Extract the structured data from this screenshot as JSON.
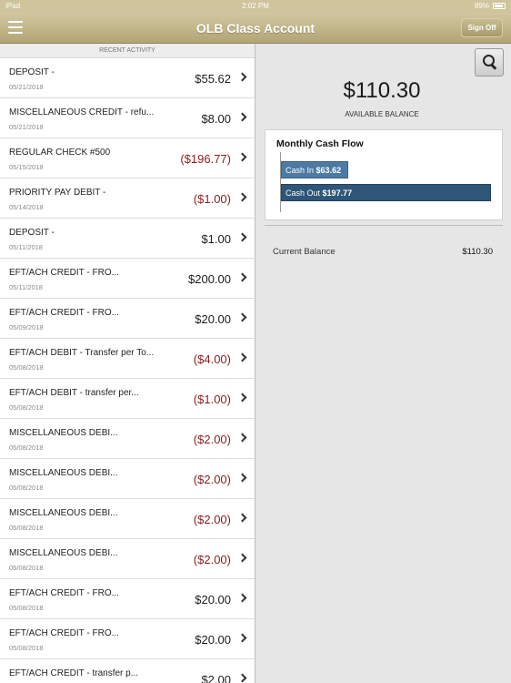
{
  "status_bar": {
    "device": "iPad",
    "time": "2:02 PM",
    "battery": "89%"
  },
  "nav": {
    "title": "OLB Class Account",
    "sign_off": "Sign Off"
  },
  "activity": {
    "header": "RECENT ACTIVITY",
    "transactions": [
      {
        "desc": "DEPOSIT -",
        "date": "05/21/2018",
        "amount": "$55.62",
        "negative": false
      },
      {
        "desc": "MISCELLANEOUS CREDIT - refu...",
        "date": "05/21/2018",
        "amount": "$8.00",
        "negative": false
      },
      {
        "desc": "REGULAR CHECK #500",
        "date": "05/15/2018",
        "amount": "($196.77)",
        "negative": true
      },
      {
        "desc": "PRIORITY PAY DEBIT -",
        "date": "05/14/2018",
        "amount": "($1.00)",
        "negative": true
      },
      {
        "desc": "DEPOSIT -",
        "date": "05/11/2018",
        "amount": "$1.00",
        "negative": false
      },
      {
        "desc": "EFT/ACH CREDIT - FRO...",
        "date": "05/11/2018",
        "amount": "$200.00",
        "negative": false
      },
      {
        "desc": "EFT/ACH CREDIT - FRO...",
        "date": "05/09/2018",
        "amount": "$20.00",
        "negative": false
      },
      {
        "desc": "EFT/ACH DEBIT - Transfer per To...",
        "date": "05/08/2018",
        "amount": "($4.00)",
        "negative": true
      },
      {
        "desc": "EFT/ACH DEBIT - transfer per...",
        "date": "05/08/2018",
        "amount": "($1.00)",
        "negative": true
      },
      {
        "desc": "MISCELLANEOUS DEBI...",
        "date": "05/08/2018",
        "amount": "($2.00)",
        "negative": true
      },
      {
        "desc": "MISCELLANEOUS DEBI...",
        "date": "05/08/2018",
        "amount": "($2.00)",
        "negative": true
      },
      {
        "desc": "MISCELLANEOUS DEBI...",
        "date": "05/08/2018",
        "amount": "($2.00)",
        "negative": true
      },
      {
        "desc": "MISCELLANEOUS DEBI...",
        "date": "05/08/2018",
        "amount": "($2.00)",
        "negative": true
      },
      {
        "desc": "EFT/ACH CREDIT - FRO...",
        "date": "05/08/2018",
        "amount": "$20.00",
        "negative": false
      },
      {
        "desc": "EFT/ACH CREDIT - FRO...",
        "date": "05/08/2018",
        "amount": "$20.00",
        "negative": false
      },
      {
        "desc": "EFT/ACH CREDIT - transfer p...",
        "date": "",
        "amount": "$2.00",
        "negative": false
      }
    ]
  },
  "summary": {
    "available_balance": "$110.30",
    "available_label": "AVAILABLE BALANCE",
    "cash_flow": {
      "title": "Monthly Cash Flow",
      "cash_in_label": "Cash In",
      "cash_in_value": "$63.62",
      "cash_out_label": "Cash Out",
      "cash_out_value": "$197.77"
    },
    "current_balance_label": "Current Balance",
    "current_balance_value": "$110.30"
  },
  "icons": [
    "menu-icon",
    "search-icon",
    "chevron-right-icon",
    "battery-icon"
  ],
  "colors": {
    "nav": "#b2a575",
    "negative": "#8e1b1b",
    "cash_in": "#4c7aa3",
    "cash_out": "#2e5677"
  }
}
